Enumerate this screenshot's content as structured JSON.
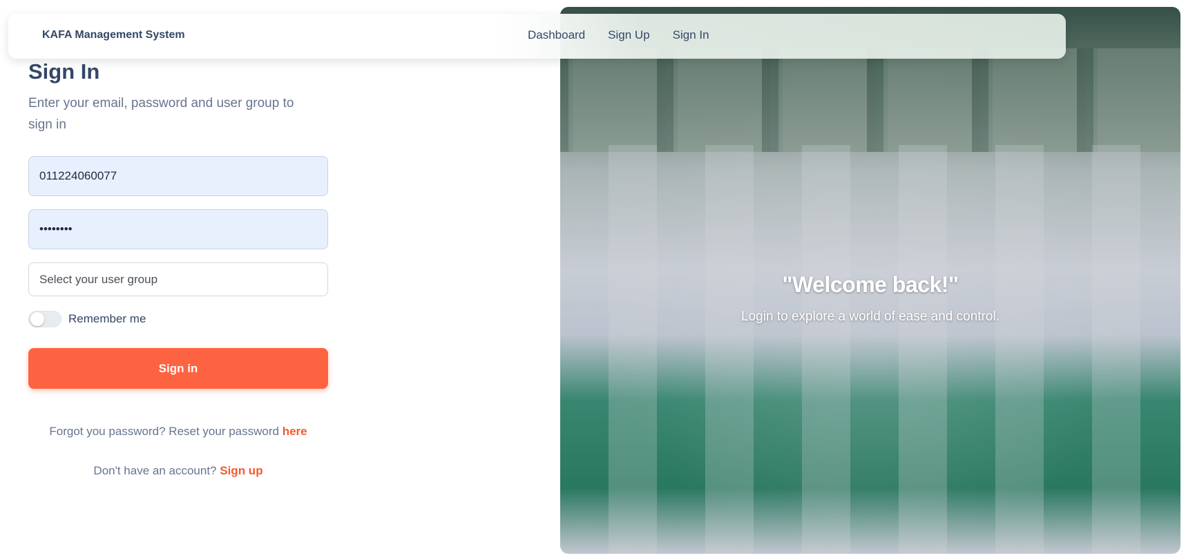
{
  "navbar": {
    "brand": "KAFA Management System",
    "links": [
      "Dashboard",
      "Sign Up",
      "Sign In"
    ]
  },
  "form": {
    "title": "Sign In",
    "subtitle": "Enter your email, password and user group to sign in",
    "email_value": "011224060077",
    "password_value": "••••••••",
    "user_group_placeholder": "Select your user group",
    "remember_label": "Remember me",
    "remember_checked": false,
    "signin_label": "Sign in",
    "forgot_text": "Forgot you password? Reset your password ",
    "forgot_link": "here",
    "noacct_text": "Don't have an account? ",
    "signup_link": "Sign up"
  },
  "hero": {
    "title": "\"Welcome back!\"",
    "subtitle": "Login to explore a world of ease and control."
  },
  "colors": {
    "accent": "#fe6341",
    "text_primary": "#344767",
    "text_secondary": "#67748e",
    "autofill_bg": "#e8f0fe"
  }
}
